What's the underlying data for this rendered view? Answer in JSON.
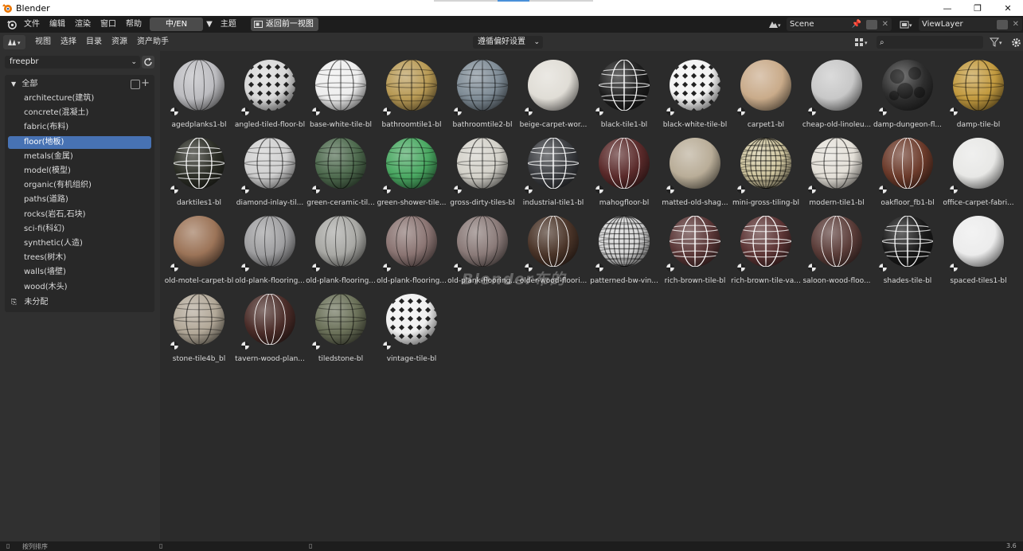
{
  "window": {
    "title": "Blender",
    "buttons": [
      "—",
      "❐",
      "✕"
    ]
  },
  "topbar": {
    "menus": [
      "文件",
      "编辑",
      "渲染",
      "窗口",
      "帮助"
    ],
    "workspace_tab": "中/EN",
    "workspace_extra": "主题",
    "back_button": "返回前一视图",
    "scene_label": "Scene",
    "viewlayer_label": "ViewLayer"
  },
  "editor_header": {
    "menus": [
      "视图",
      "选择",
      "目录",
      "资源",
      "资产助手"
    ],
    "center_dropdown": "遵循偏好设置",
    "search_placeholder": ""
  },
  "sidebar": {
    "library": "freepbr",
    "root": "全部",
    "categories": [
      {
        "label": "architecture(建筑)",
        "selected": false
      },
      {
        "label": "concrete(混凝土)",
        "selected": false
      },
      {
        "label": "fabric(布料)",
        "selected": false
      },
      {
        "label": "floor(地板)",
        "selected": true
      },
      {
        "label": "metals(金属)",
        "selected": false
      },
      {
        "label": "model(模型)",
        "selected": false
      },
      {
        "label": "organic(有机组织)",
        "selected": false
      },
      {
        "label": "paths(道路)",
        "selected": false
      },
      {
        "label": "rocks(岩石,石块)",
        "selected": false
      },
      {
        "label": "sci-fi(科幻)",
        "selected": false
      },
      {
        "label": "synthetic(人造)",
        "selected": false
      },
      {
        "label": "trees(树木)",
        "selected": false
      },
      {
        "label": "walls(墙壁)",
        "selected": false
      },
      {
        "label": "wood(木头)",
        "selected": false
      }
    ],
    "unassigned": "未分配"
  },
  "assets": [
    {
      "label": "agedplanks1-bl",
      "color": "#bcbcc0",
      "pattern": "planks"
    },
    {
      "label": "angled-tiled-floor-bl",
      "color": "#d8d8d8",
      "pattern": "diamond"
    },
    {
      "label": "base-white-tile-bl",
      "color": "#eeeeee",
      "pattern": "grid"
    },
    {
      "label": "bathroomtile1-bl",
      "color": "#b89a55",
      "pattern": "grid"
    },
    {
      "label": "bathroomtile2-bl",
      "color": "#7f8c96",
      "pattern": "grid"
    },
    {
      "label": "beige-carpet-wor...",
      "color": "#e0ddd6",
      "pattern": "plain"
    },
    {
      "label": "black-tile1-bl",
      "color": "#1e1e1e",
      "pattern": "gridlight"
    },
    {
      "label": "black-white-tile-bl",
      "color": "#f2f2f2",
      "pattern": "diamond"
    },
    {
      "label": "carpet1-bl",
      "color": "#c9ab8a",
      "pattern": "plain"
    },
    {
      "label": "cheap-old-linoleu...",
      "color": "#c8c8c8",
      "pattern": "plain"
    },
    {
      "label": "damp-dungeon-fl...",
      "color": "#2e2e2e",
      "pattern": "rock"
    },
    {
      "label": "damp-tile-bl",
      "color": "#c29a3f",
      "pattern": "grid"
    },
    {
      "label": "darktiles1-bl",
      "color": "#2c2e26",
      "pattern": "grid"
    },
    {
      "label": "diamond-inlay-til...",
      "color": "#d0d0d0",
      "pattern": "grid"
    },
    {
      "label": "green-ceramic-til...",
      "color": "#4e6a4e",
      "pattern": "grid"
    },
    {
      "label": "green-shower-tile...",
      "color": "#4aa862",
      "pattern": "grid"
    },
    {
      "label": "gross-dirty-tiles-bl",
      "color": "#d4d2ca",
      "pattern": "grid"
    },
    {
      "label": "industrial-tile1-bl",
      "color": "#3a3c40",
      "pattern": "grid"
    },
    {
      "label": "mahogfloor-bl",
      "color": "#5a2a2a",
      "pattern": "planks"
    },
    {
      "label": "matted-old-shag...",
      "color": "#b9ad98",
      "pattern": "plain"
    },
    {
      "label": "mini-gross-tiling-bl",
      "color": "#d0c6a0",
      "pattern": "finegrid"
    },
    {
      "label": "modern-tile1-bl",
      "color": "#e4e0d8",
      "pattern": "grid"
    },
    {
      "label": "oakfloor_fb1-bl",
      "color": "#6b3a2a",
      "pattern": "planks"
    },
    {
      "label": "office-carpet-fabri...",
      "color": "#e8e8e6",
      "pattern": "plain"
    },
    {
      "label": "old-motel-carpet-bl",
      "color": "#9c7458",
      "pattern": "plain"
    },
    {
      "label": "old-plank-flooring...",
      "color": "#9e9ea0",
      "pattern": "planks"
    },
    {
      "label": "old-plank-flooring...",
      "color": "#a8a8a4",
      "pattern": "planks"
    },
    {
      "label": "old-plank-flooring...",
      "color": "#8a7472",
      "pattern": "planks"
    },
    {
      "label": "old-plank-flooring...",
      "color": "#8a7a78",
      "pattern": "planks"
    },
    {
      "label": "older-wood-floori...",
      "color": "#4a3428",
      "pattern": "planks"
    },
    {
      "label": "patterned-bw-vin...",
      "color": "#d6d6d6",
      "pattern": "finegrid"
    },
    {
      "label": "rich-brown-tile-bl",
      "color": "#5a3636",
      "pattern": "grid"
    },
    {
      "label": "rich-brown-tile-va...",
      "color": "#5c3434",
      "pattern": "grid"
    },
    {
      "label": "saloon-wood-floo...",
      "color": "#5a3c38",
      "pattern": "planks"
    },
    {
      "label": "shades-tile-bl",
      "color": "#1a1a1a",
      "pattern": "gridlight"
    },
    {
      "label": "spaced-tiles1-bl",
      "color": "#ececec",
      "pattern": "plain"
    },
    {
      "label": "stone-tile4b_bl",
      "color": "#b2a898",
      "pattern": "grid"
    },
    {
      "label": "tavern-wood-plan...",
      "color": "#4a2c28",
      "pattern": "planks"
    },
    {
      "label": "tiledstone-bl",
      "color": "#6a7058",
      "pattern": "grid"
    },
    {
      "label": "vintage-tile-bl",
      "color": "#f0f0f0",
      "pattern": "diamond"
    }
  ],
  "watermark": "Blender布的",
  "statusbar": {
    "left": "按列排序",
    "version": "3.6"
  },
  "colors": {
    "selected": "#4772b3",
    "header": "#1d1d1d",
    "panel": "#303030"
  }
}
